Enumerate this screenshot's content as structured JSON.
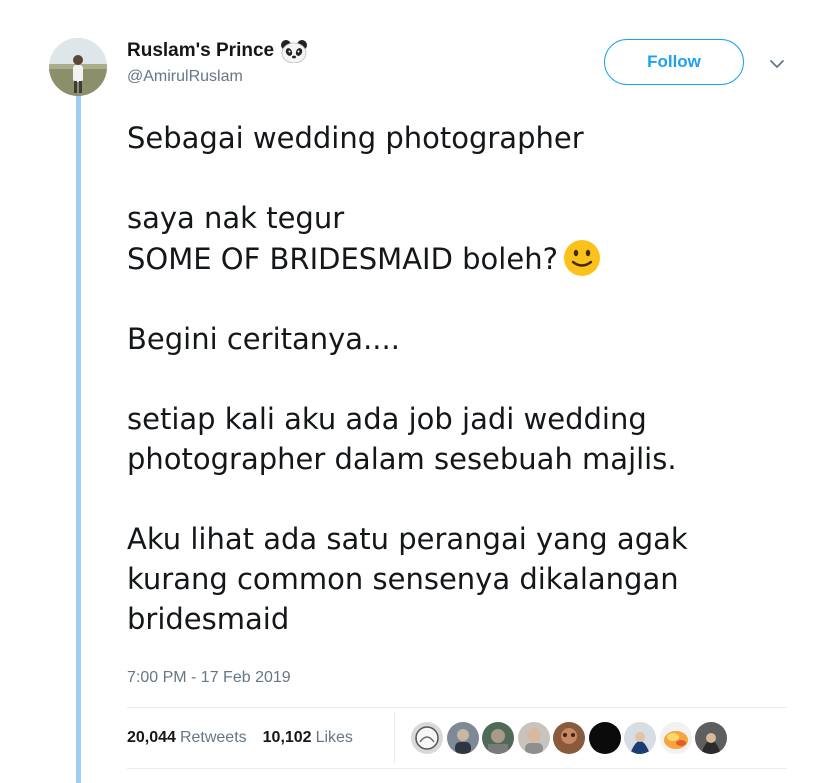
{
  "tweet": {
    "author": {
      "display_name": "Ruslam's Prince",
      "handle": "@AmirulRuslam",
      "name_emoji": "panda-face-icon"
    },
    "follow_label": "Follow",
    "paragraphs": [
      [
        "Sebagai wedding photographer"
      ],
      [
        "saya nak tegur",
        "SOME OF BRIDESMAID boleh?"
      ],
      [
        "Begini ceritanya...."
      ],
      [
        "setiap kali aku ada job jadi wedding",
        "photographer dalam sesebuah majlis."
      ],
      [
        "Aku lihat ada satu perangai yang agak",
        "kurang common sensenya dikalangan",
        "bridesmaid"
      ]
    ],
    "inline_emoji": "slightly-smiling-face-icon",
    "timestamp": "7:00 PM - 17 Feb 2019",
    "stats": {
      "retweets_count": "20,044",
      "retweets_label": "Retweets",
      "likes_count": "10,102",
      "likes_label": "Likes"
    },
    "liker_avatars": 10
  },
  "colors": {
    "accent": "#1da1f2",
    "thread_line": "#9fcff0",
    "secondary_text": "#657786",
    "primary_text": "#14171a"
  }
}
